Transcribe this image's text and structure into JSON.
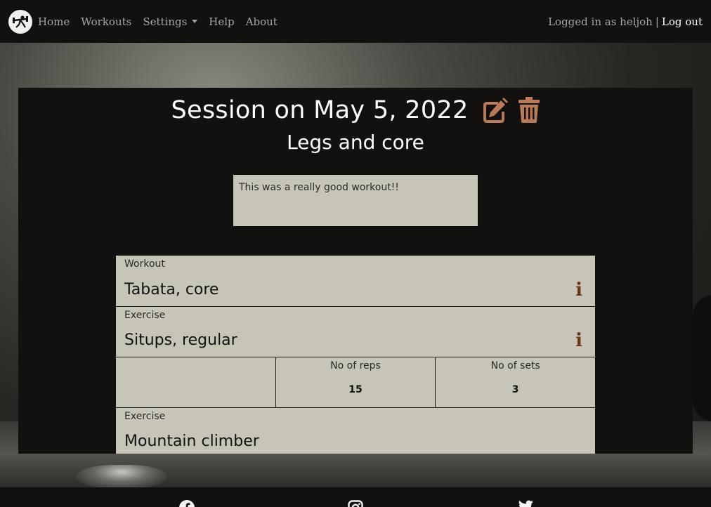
{
  "navbar": {
    "logo_icon": "dumbbell-lifter-icon",
    "links": [
      "Home",
      "Workouts",
      "Settings",
      "Help",
      "About"
    ],
    "logged_in_text": "Logged in as heljoh",
    "separator": "|",
    "logout_label": "Log out"
  },
  "session": {
    "title": "Session on May 5, 2022",
    "subtitle": "Legs and core",
    "notes": "This was a really good workout!!",
    "edit_icon": "edit-icon",
    "delete_icon": "trash-icon",
    "icon_color": "#b87a58"
  },
  "table": {
    "workout_label": "Workout",
    "workout_value": "Tabata, core",
    "exercises": [
      {
        "label": "Exercise",
        "value": "Situps, regular",
        "reps_label": "No of reps",
        "reps": "15",
        "sets_label": "No of sets",
        "sets": "3"
      },
      {
        "label": "Exercise",
        "value": "Mountain climber"
      }
    ],
    "info_icon_text": "i",
    "info_color": "#6b3a1e"
  },
  "footer": {
    "icons": [
      "facebook-icon",
      "instagram-icon",
      "twitter-icon"
    ]
  }
}
